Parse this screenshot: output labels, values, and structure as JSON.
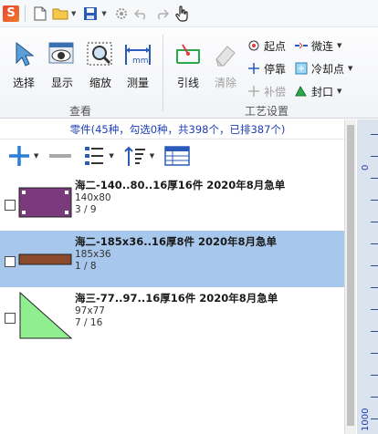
{
  "ribbon": {
    "groups": {
      "view": {
        "label": "查看"
      },
      "process": {
        "label": "工艺设置"
      }
    },
    "buttons": {
      "select": "选择",
      "display": "显示",
      "zoom": "缩放",
      "measure": "测量",
      "leadline": "引线",
      "clear": "清除"
    },
    "small_buttons": {
      "start_point": "起点",
      "micro_joint": "微连",
      "stop": "停靠",
      "cooling_point": "冷却点",
      "compensation": "补偿",
      "seal": "封口"
    }
  },
  "panel": {
    "header": "零件(45种，勾选0种，共398个，已排387个)",
    "items": [
      {
        "title": "海二-140..80..16厚16件 2020年8月急单",
        "dims": "140x80",
        "qty": "3 / 9",
        "selected": false,
        "shape": "rect-purple"
      },
      {
        "title": "海二-185x36..16厚8件 2020年8月急单",
        "dims": "185x36",
        "qty": "1 / 8",
        "selected": true,
        "shape": "rect-brown"
      },
      {
        "title": "海三-77..97..16厚16件 2020年8月急单",
        "dims": "97x77",
        "qty": "7 / 16",
        "selected": false,
        "shape": "triangle-green"
      }
    ]
  },
  "ruler": {
    "labels": [
      "0",
      "1000"
    ]
  },
  "icons": {
    "qat": [
      "app-logo-icon",
      "new-file-icon",
      "open-folder-icon",
      "save-icon",
      "settings-gear-icon",
      "undo-icon",
      "redo-icon",
      "hand-pointer-icon"
    ],
    "toolbar": [
      "add-icon",
      "remove-icon",
      "list-view-icon",
      "sort-icon",
      "table-view-icon"
    ]
  },
  "colors": {
    "accent_blue": "#1f3fb5",
    "selection": "#a8c7ec",
    "purple_part": "#7a3a7c",
    "brown_part": "#8b4a2b",
    "green_part": "#90ee90"
  }
}
